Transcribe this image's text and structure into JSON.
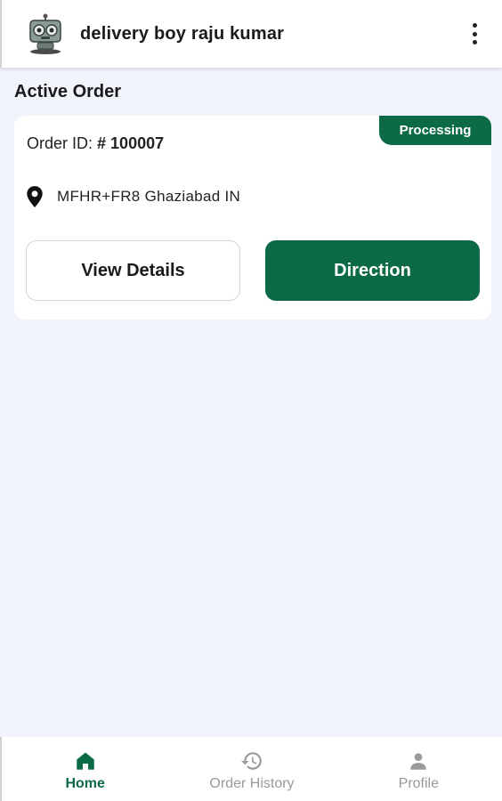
{
  "header": {
    "title": "delivery boy raju kumar",
    "avatar_icon": "robot-avatar",
    "menu_icon": "more-vertical-icon"
  },
  "active_order": {
    "section_title": "Active Order",
    "status": "Processing",
    "order_id_label": "Order ID:",
    "order_id_value": "# 100007",
    "address": "MFHR+FR8 Ghaziabad IN",
    "view_details_label": "View Details",
    "direction_label": "Direction"
  },
  "bottom_nav": {
    "items": [
      {
        "label": "Home",
        "icon": "home-icon",
        "active": true
      },
      {
        "label": "Order History",
        "icon": "history-icon",
        "active": false
      },
      {
        "label": "Profile",
        "icon": "person-icon",
        "active": false
      }
    ]
  },
  "colors": {
    "primary": "#0c6b46",
    "background": "#f1f4fa",
    "inactive": "#9a9a9a"
  }
}
